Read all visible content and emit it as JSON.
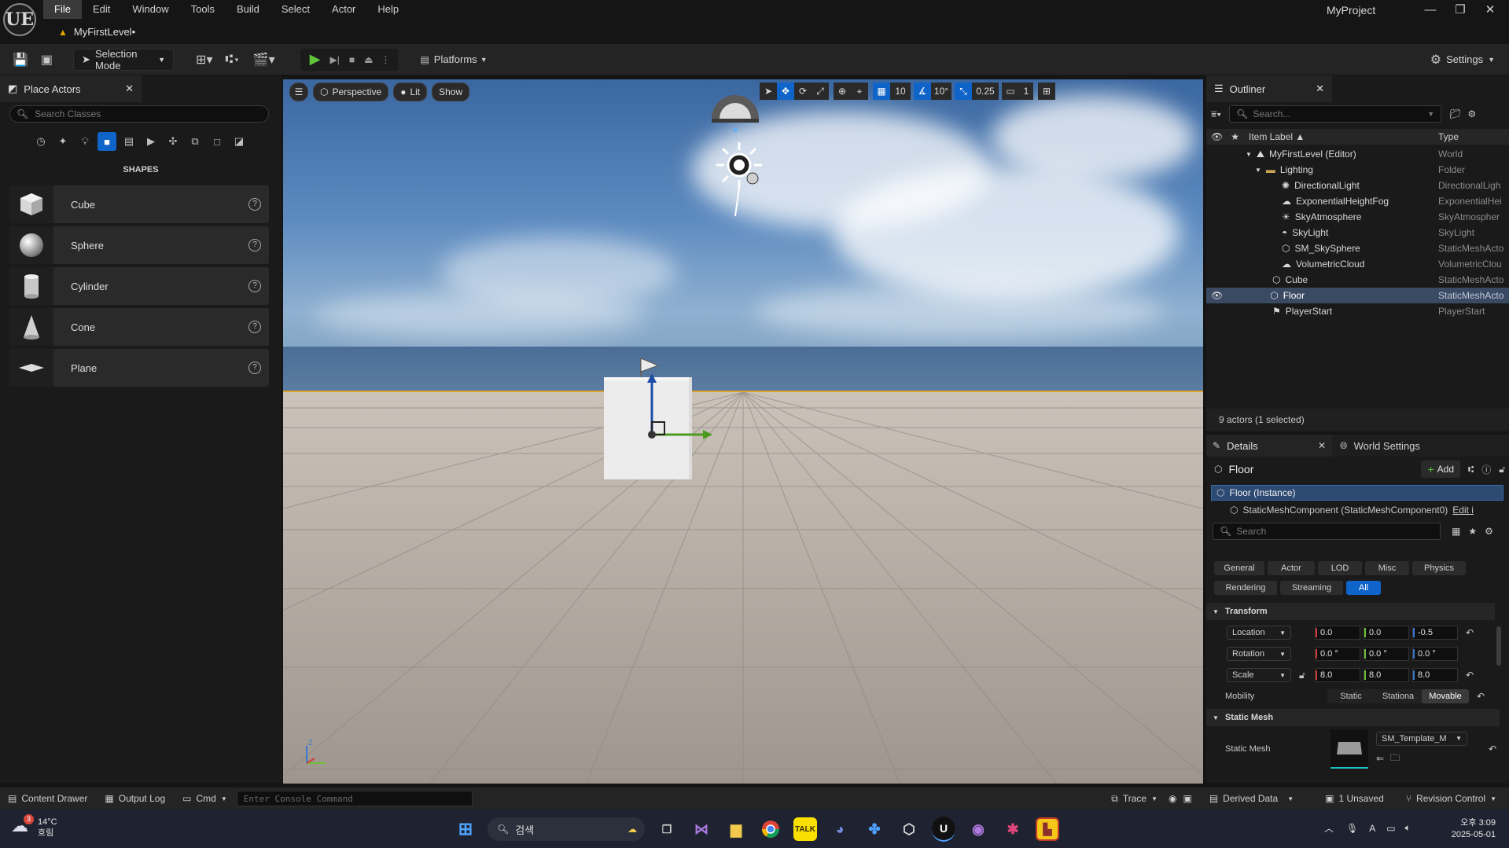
{
  "app": {
    "logo": "UE",
    "project": "MyProject",
    "menu": [
      "File",
      "Edit",
      "Window",
      "Tools",
      "Build",
      "Select",
      "Actor",
      "Help"
    ],
    "document_tab": "MyFirstLevel•"
  },
  "toolbar": {
    "selection_mode": "Selection Mode",
    "platforms": "Platforms",
    "settings": "Settings"
  },
  "place_actors": {
    "title": "Place Actors",
    "search_placeholder": "Search Classes",
    "section": "SHAPES",
    "items": [
      "Cube",
      "Sphere",
      "Cylinder",
      "Cone",
      "Plane"
    ]
  },
  "viewport": {
    "perspective": "Perspective",
    "lit": "Lit",
    "show": "Show",
    "grid_snap": "10",
    "rotation_snap": "10°",
    "scale_snap": "0.25",
    "camera_speed": "1"
  },
  "outliner": {
    "title": "Outliner",
    "search_placeholder": "Search...",
    "col_label": "Item Label ▲",
    "col_type": "Type",
    "rows": [
      {
        "label": "MyFirstLevel (Editor)",
        "type": "World"
      },
      {
        "label": "Lighting",
        "type": "Folder"
      },
      {
        "label": "DirectionalLight",
        "type": "DirectionalLigh"
      },
      {
        "label": "ExponentialHeightFog",
        "type": "ExponentialHei"
      },
      {
        "label": "SkyAtmosphere",
        "type": "SkyAtmospher"
      },
      {
        "label": "SkyLight",
        "type": "SkyLight"
      },
      {
        "label": "SM_SkySphere",
        "type": "StaticMeshActo"
      },
      {
        "label": "VolumetricCloud",
        "type": "VolumetricClou"
      },
      {
        "label": "Cube",
        "type": "StaticMeshActo"
      },
      {
        "label": "Floor",
        "type": "StaticMeshActo"
      },
      {
        "label": "PlayerStart",
        "type": "PlayerStart"
      }
    ],
    "status": "9 actors (1 selected)"
  },
  "details": {
    "tab": "Details",
    "world_settings_tab": "World Settings",
    "actor_name": "Floor",
    "add": "Add",
    "instance": "Floor (Instance)",
    "component": "StaticMeshComponent (StaticMeshComponent0)",
    "edit_link": "Edit i",
    "search_placeholder": "Search",
    "filters_row1": [
      "General",
      "Actor",
      "LOD",
      "Misc",
      "Physics"
    ],
    "filters_row2": [
      "Rendering",
      "Streaming",
      "All"
    ],
    "transform_section": "Transform",
    "location": {
      "label": "Location",
      "x": "0.0",
      "y": "0.0",
      "z": "-0.5"
    },
    "rotation": {
      "label": "Rotation",
      "x": "0.0 °",
      "y": "0.0 °",
      "z": "0.0 °"
    },
    "scale": {
      "label": "Scale",
      "x": "8.0",
      "y": "8.0",
      "z": "8.0"
    },
    "mobility": {
      "label": "Mobility",
      "options": [
        "Static",
        "Stationa",
        "Movable"
      ]
    },
    "static_mesh_section": "Static Mesh",
    "static_mesh_label": "Static Mesh",
    "static_mesh_value": "SM_Template_M"
  },
  "statusbar": {
    "content_drawer": "Content Drawer",
    "output_log": "Output Log",
    "cmd": "Cmd",
    "console_placeholder": "Enter Console Command",
    "trace": "Trace",
    "derived_data": "Derived Data",
    "unsaved": "1 Unsaved",
    "revision_control": "Revision Control"
  },
  "taskbar": {
    "weather_badge": "3",
    "temperature": "14°C",
    "condition": "흐림",
    "search": "검색",
    "time": "오후 3:09",
    "date": "2025-05-01"
  },
  "colors": {
    "accent": "#0e64c8",
    "play_green": "#5ec43a",
    "selection_outline": "#e3a02a"
  }
}
